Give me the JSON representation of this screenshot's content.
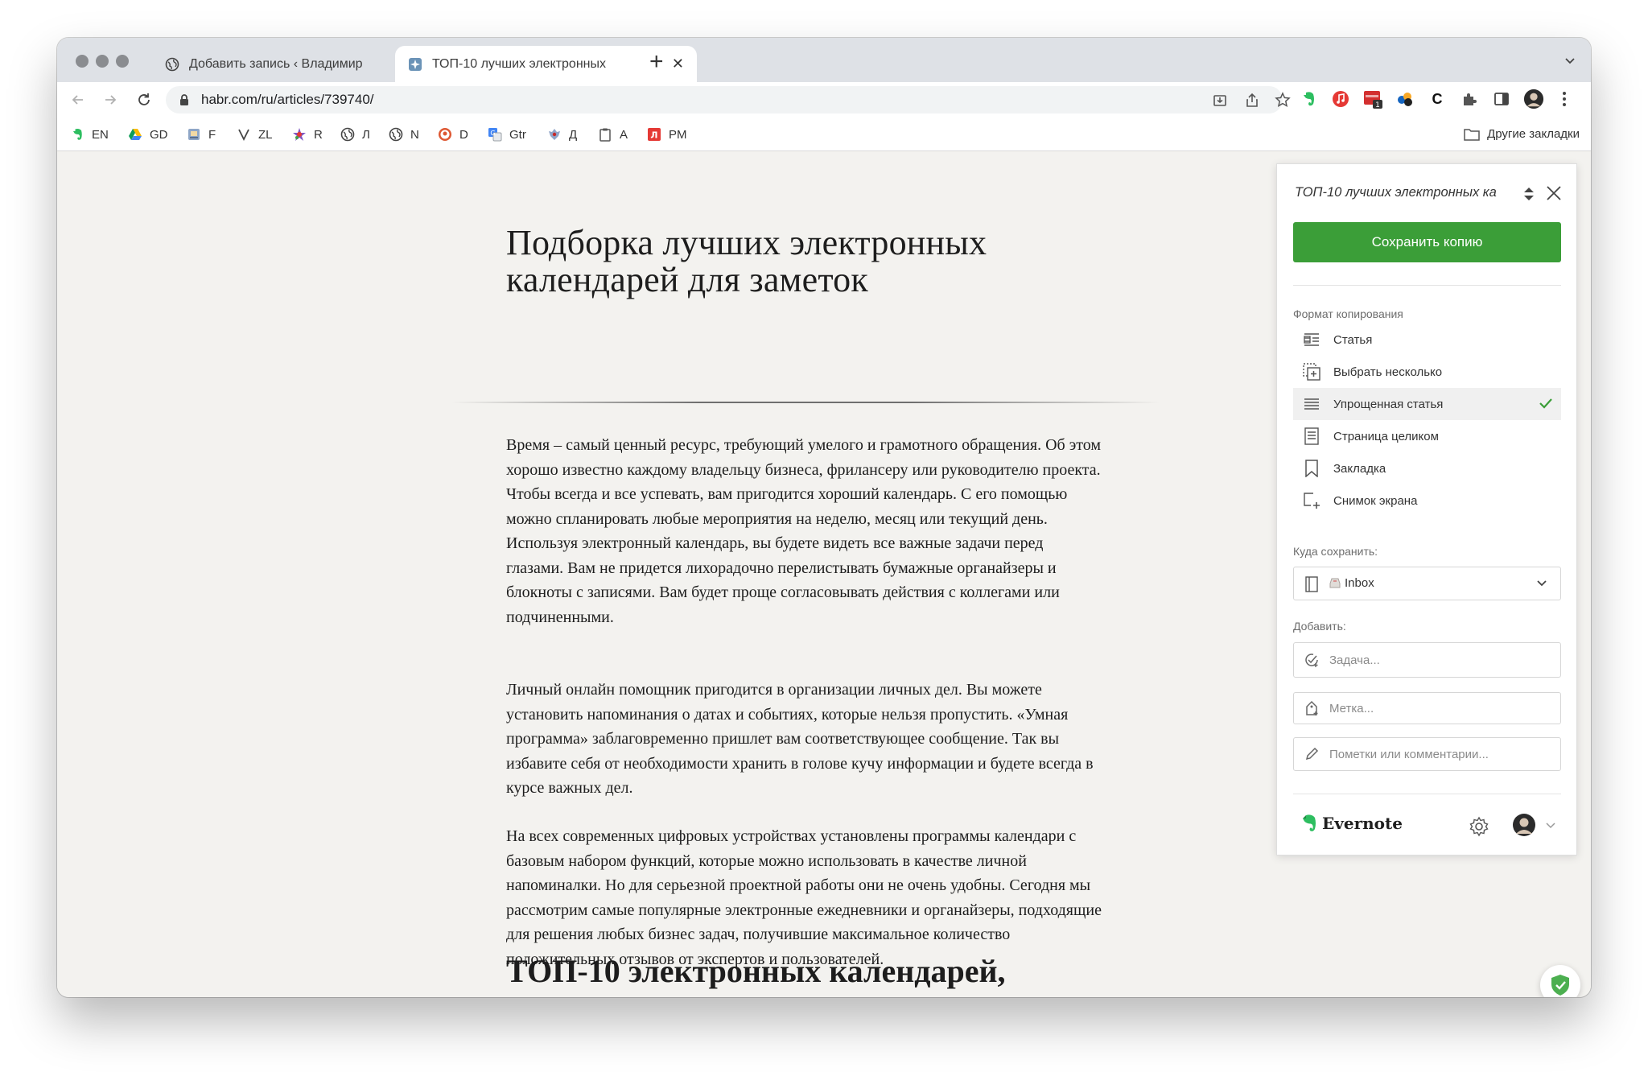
{
  "browser": {
    "tabs": [
      {
        "title": "Добавить запись ‹ Владимир",
        "active": false
      },
      {
        "title": "ТОП-10 лучших электронных",
        "active": true
      }
    ],
    "new_tab_label": "+",
    "url": "habr.com/ru/articles/739740/",
    "extension_badge": "1",
    "extension_c_label": "C"
  },
  "bookmarks": {
    "items": [
      {
        "label": "EN",
        "icon": "evernote-icon"
      },
      {
        "label": "GD",
        "icon": "google-drive-icon"
      },
      {
        "label": "F",
        "icon": "f-icon"
      },
      {
        "label": "ZL",
        "icon": "v-icon"
      },
      {
        "label": "R",
        "icon": "star-icon"
      },
      {
        "label": "Л",
        "icon": "globe-icon"
      },
      {
        "label": "N",
        "icon": "globe-icon"
      },
      {
        "label": "D",
        "icon": "duckduckgo-icon"
      },
      {
        "label": "Gtr",
        "icon": "translate-icon"
      },
      {
        "label": "Д",
        "icon": "emblem-icon"
      },
      {
        "label": "A",
        "icon": "clipboard-icon"
      },
      {
        "label": "PM",
        "icon": "red-l-icon"
      }
    ],
    "other_label": "Другие закладки"
  },
  "article": {
    "title": "Подборка лучших электронных календарей для заметок",
    "paragraphs": [
      "Время – самый ценный ресурс, требующий умелого и грамотного обращения. Об этом хорошо известно каждому владельцу бизнеса, фрилансеру или руководителю проекта. Чтобы всегда и все успевать, вам пригодится хороший календарь. С его помощью можно спланировать любые мероприятия на неделю, месяц или текущий день. Используя электронный календарь, вы будете видеть все важные задачи перед глазами. Вам не придется лихорадочно перелистывать бумажные органайзеры и блокноты с записями. Вам будет проще согласовывать действия с коллегами или подчиненными.",
      "Личный онлайн помощник пригодится в организации личных дел. Вы можете установить напоминания о датах и событиях, которые нельзя пропустить. «Умная программа» заблаговременно пришлет вам соответствующее сообщение. Так вы избавите себя от необходимости хранить в голове кучу информации и будете всегда в курсе важных дел.",
      "На всех современных цифровых устройствах установлены программы календари с базовым набором функций, которые можно использовать в качестве личной напоминалки. Но для серьезной проектной работы они не очень удобны. Сегодня мы рассмотрим самые популярные электронные ежедневники и органайзеры, подходящие для решения любых бизнес задач, получившие максимальное количество положительных отзывов от экспертов и пользователей."
    ],
    "subheading": "ТОП-10 электронных календарей,"
  },
  "clipper": {
    "title": "ТОП-10 лучших электронных ка",
    "save_button": "Сохранить копию",
    "format_label": "Формат копирования",
    "format_options": [
      {
        "label": "Статья",
        "icon": "article-icon",
        "selected": false
      },
      {
        "label": "Выбрать несколько",
        "icon": "select-multiple-icon",
        "selected": false
      },
      {
        "label": "Упрощенная статья",
        "icon": "simplified-article-icon",
        "selected": true
      },
      {
        "label": "Страница целиком",
        "icon": "full-page-icon",
        "selected": false
      },
      {
        "label": "Закладка",
        "icon": "bookmark-icon",
        "selected": false
      },
      {
        "label": "Снимок экрана",
        "icon": "screenshot-icon",
        "selected": false
      }
    ],
    "save_to_label": "Куда сохранить:",
    "notebook_value": "Inbox",
    "add_label": "Добавить:",
    "task_placeholder": "Задача...",
    "tag_placeholder": "Метка...",
    "comment_placeholder": "Пометки или комментарии...",
    "brand": "Evernote",
    "accent_color": "#3b9e38"
  }
}
